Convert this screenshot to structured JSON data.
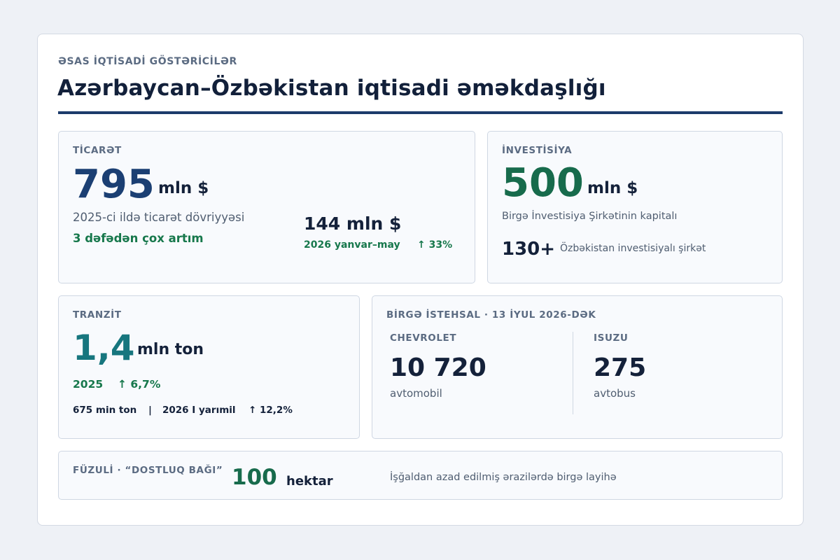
{
  "header": {
    "eyebrow": "ƏSAS İQTİSADİ GÖSTƏRİCİLƏR",
    "title": "Azərbaycan–Özbəkistan iqtisadi əməkdaşlığı"
  },
  "colors": {
    "navy": "#1c3b6b",
    "trade_blue": "#1b3f73",
    "invest_green": "#176b4c",
    "transit_teal": "#17767e",
    "positive_green": "#17784c"
  },
  "trade": {
    "label": "TİCARƏT",
    "value": "795",
    "unit": "mln $",
    "caption": "2025-ci ildə ticarət dövriyyəsi",
    "growth": "3 dəfədən çox artım",
    "sub_value": "144 mln $",
    "sub_period": "2026 yanvar–may",
    "sub_change": "↑ 33%"
  },
  "investment": {
    "label": "İNVESTİSİYA",
    "value": "500",
    "unit": "mln $",
    "caption": "Birgə İnvestisiya Şirkətinin kapitalı",
    "companies_count": "130+",
    "companies_label": "Özbəkistan investisiyalı şirkət"
  },
  "transit": {
    "label": "TRANZİT",
    "value": "1,4",
    "unit": "mln ton",
    "year": "2025",
    "change": "↑ 6,7%",
    "sub_value": "675 min ton",
    "separator": "|",
    "sub_period": "2026 I yarımil",
    "sub_change": "↑ 12,2%"
  },
  "production": {
    "label": "BİRGƏ İSTEHSAL · 13 İYUL 2026-DƏK",
    "items": [
      {
        "brand": "CHEVROLET",
        "value": "10 720",
        "unit": "avtomobil"
      },
      {
        "brand": "ISUZU",
        "value": "275",
        "unit": "avtobus"
      }
    ]
  },
  "fuzuli": {
    "label": "FÜZULİ · “DOSTLUQ BAĞI”",
    "value": "100",
    "unit": "hektar",
    "caption": "İşğaldan azad edilmiş ərazilərdə birgə layihə"
  }
}
